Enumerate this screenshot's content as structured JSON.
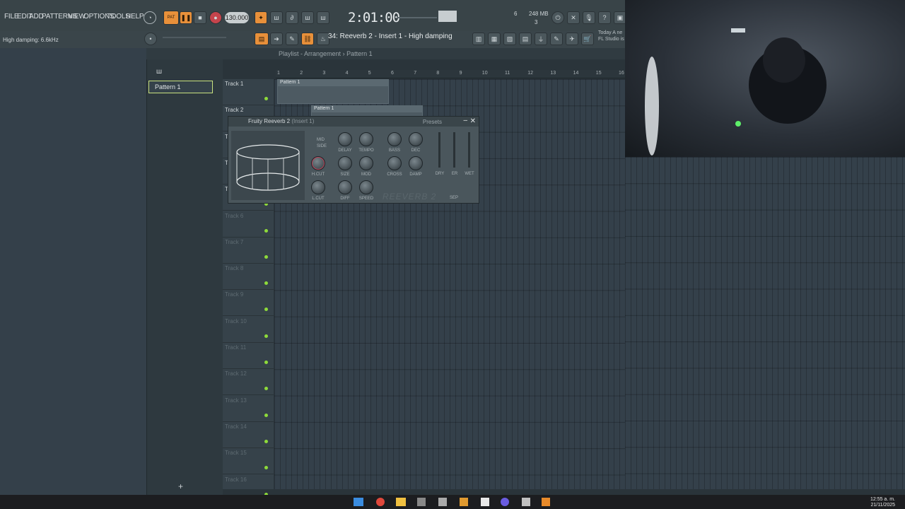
{
  "menu": [
    "FILE",
    "EDIT",
    "ADD",
    "PATTERNS",
    "VIEW",
    "OPTIONS",
    "TOOLS",
    "HELP"
  ],
  "transport": {
    "pat_label": "PAT",
    "tempo": "130.000",
    "time": "2:01:00",
    "cpu": "6",
    "memory": "248 MB",
    "mem_count": "3"
  },
  "hint_left": "High damping: 6.6kHz",
  "hint_bar": "34: Reeverb 2 - Insert 1 - High damping",
  "news": [
    "Today  A ne",
    "FL Studio is"
  ],
  "playlist": {
    "title": "Playlist - Arrangement",
    "pattern": "Pattern 1",
    "ruler": [
      "1",
      "2",
      "3",
      "4",
      "5",
      "6",
      "7",
      "8",
      "9",
      "10",
      "11",
      "12",
      "13",
      "14",
      "15",
      "16"
    ],
    "tracks": [
      "Track 1",
      "Track 2",
      "Track 3",
      "Track 4",
      "Track 5",
      "Track 6",
      "Track 7",
      "Track 8",
      "Track 9",
      "Track 10",
      "Track 11",
      "Track 12",
      "Track 13",
      "Track 14",
      "Track 15",
      "Track 16"
    ],
    "clips": [
      {
        "label": "Pattern 1"
      },
      {
        "label": "Pattern 1"
      }
    ]
  },
  "browser": {
    "pattern_item": "Pattern 1",
    "add_label": "+"
  },
  "plugin": {
    "title": "Fruity Reeverb 2",
    "subtitle": "(Insert 1)",
    "presets": "Presets",
    "mode": [
      "MID",
      "SIDE"
    ],
    "knobs": [
      "DELAY",
      "TEMPO",
      "BASS",
      "DEC",
      "H.CUT",
      "SIZE",
      "MOD",
      "CROSS",
      "DAMP",
      "L.CUT",
      "DIFF",
      "SPEED"
    ],
    "faders": [
      "DRY",
      "ER",
      "WET"
    ],
    "sep": "SEP",
    "logo": "REEVERB 2"
  },
  "clock": {
    "time": "12:55 a. m.",
    "date": "21/11/2025"
  }
}
